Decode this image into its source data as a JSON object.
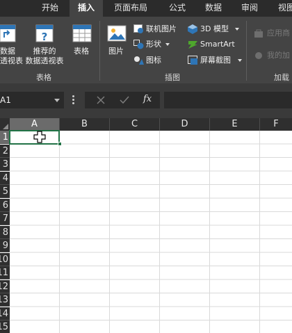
{
  "tabs": [
    {
      "label": ""
    },
    {
      "label": "开始"
    },
    {
      "label": "插入"
    },
    {
      "label": "页面布局"
    },
    {
      "label": "公式"
    },
    {
      "label": "数据"
    },
    {
      "label": "审阅"
    },
    {
      "label": "视图"
    }
  ],
  "active_tab": "插入",
  "ribbon": {
    "tables_group": {
      "pivot_table": "数据\n透视表",
      "recommended_pivot": "推荐的\n数据透视表",
      "table": "表格",
      "group_label": "表格"
    },
    "illustrations_group": {
      "picture": "图片",
      "online_pictures": "联机图片",
      "shapes": "形状",
      "icons": "图标",
      "models_3d": "3D 模型",
      "smartart": "SmartArt",
      "screenshot": "屏幕截图",
      "group_label": "插图"
    },
    "addins_group": {
      "get_addins": "应用商",
      "my_addins": "我的加",
      "group_label": "加载"
    }
  },
  "formula_bar": {
    "name_box": "A1",
    "fx_label": "fx",
    "formula_value": ""
  },
  "grid": {
    "columns": [
      "A",
      "B",
      "C",
      "D",
      "E",
      "F"
    ],
    "rows": [
      "1",
      "2",
      "3",
      "4",
      "5",
      "6",
      "7",
      "8",
      "9",
      "10",
      "11",
      "12",
      "13",
      "14",
      "15"
    ],
    "selected_cell": "A1"
  },
  "colors": {
    "tab_bg": "#2b2b2b",
    "ribbon_bg": "#444444",
    "formula_bar_bg": "#3a3a3a",
    "selection_green": "#217346",
    "header_selected": "#6b6b6b"
  }
}
